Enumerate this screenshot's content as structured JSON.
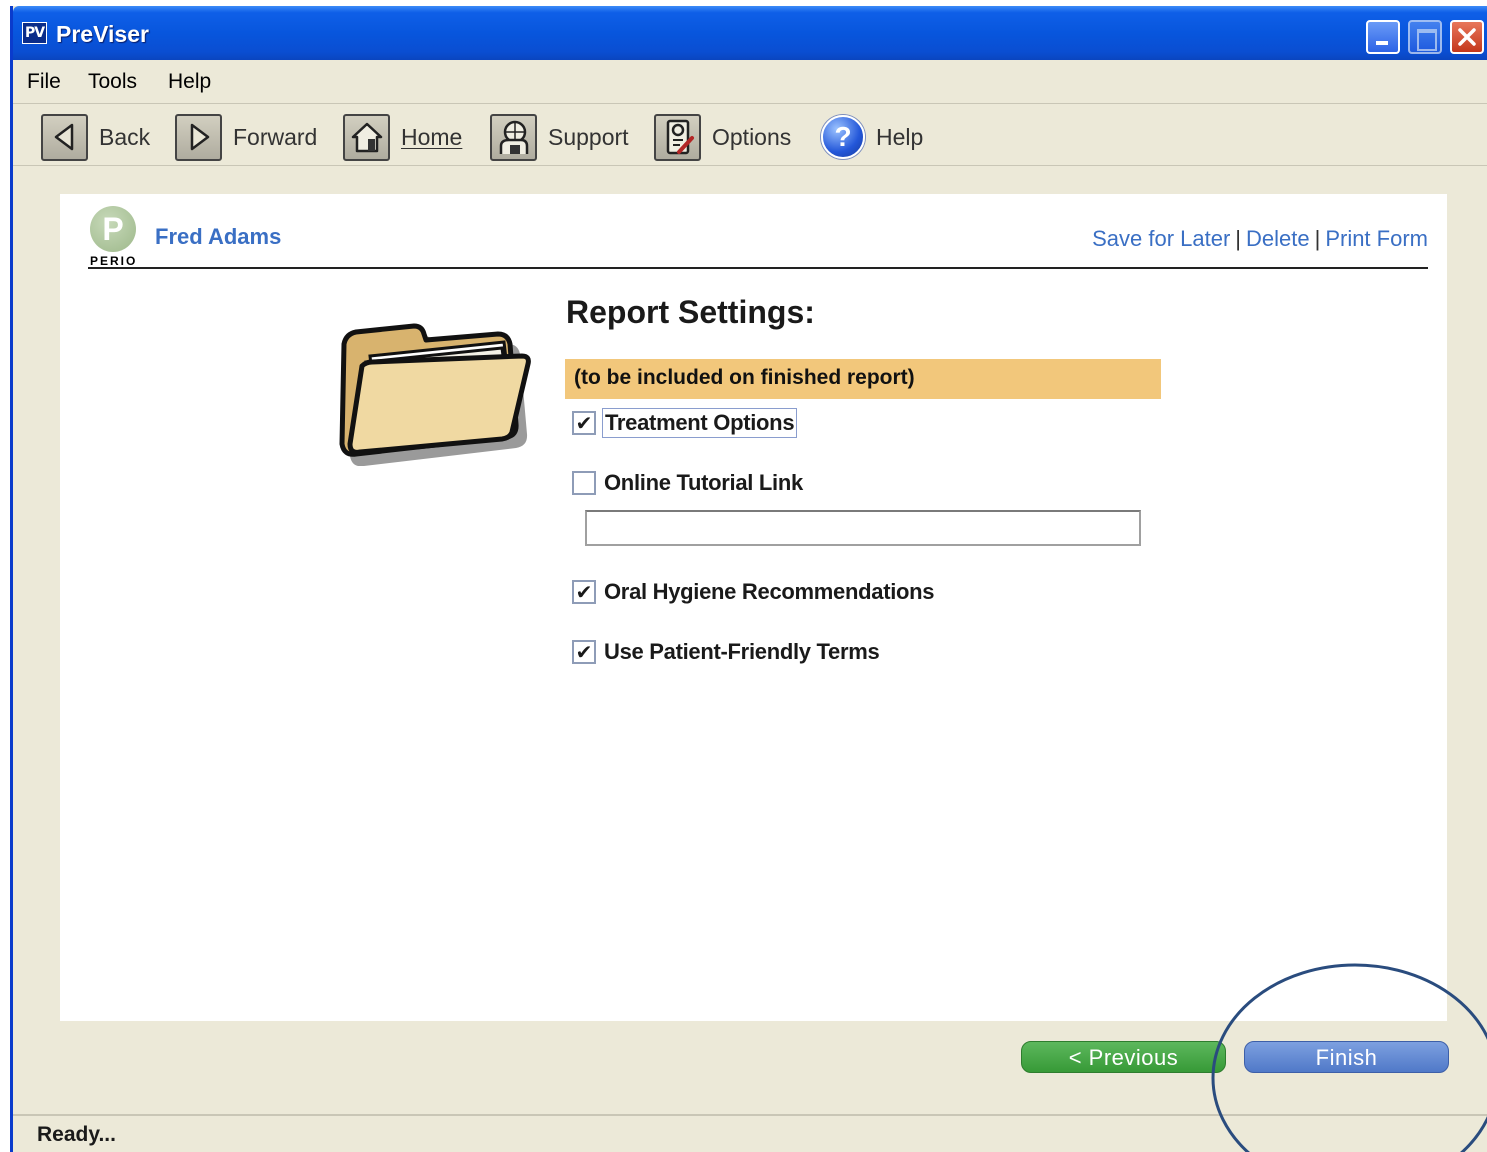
{
  "window": {
    "logo": "PV",
    "title": "PreViser"
  },
  "menu": [
    "File",
    "Tools",
    "Help"
  ],
  "toolbar": {
    "back": "Back",
    "forward": "Forward",
    "home": "Home",
    "support": "Support",
    "options": "Options",
    "help": "Help"
  },
  "header": {
    "logo_letter": "P",
    "logo_text": "PERIO",
    "patient_name": "Fred Adams",
    "links": {
      "save": "Save for Later",
      "delete": "Delete",
      "print": "Print Form",
      "separator": "|"
    }
  },
  "report": {
    "title": "Report Settings:",
    "subtitle": "(to be included on finished report)",
    "options": {
      "treatment": {
        "label": "Treatment Options",
        "checked": true
      },
      "tutorial": {
        "label": "Online Tutorial Link",
        "checked": false,
        "value": ""
      },
      "hygiene": {
        "label": "Oral Hygiene Recommendations",
        "checked": true
      },
      "patient_terms": {
        "label": "Use Patient-Friendly Terms",
        "checked": true
      }
    },
    "check_glyph": "✔"
  },
  "buttons": {
    "previous": "< Previous",
    "finish": "Finish"
  },
  "status": "Ready...",
  "colors": {
    "link": "#3A6FC4",
    "banner": "#F2C77B",
    "previous": "#379A37",
    "finish": "#5079C8",
    "annotation": "#2A4C7E"
  }
}
